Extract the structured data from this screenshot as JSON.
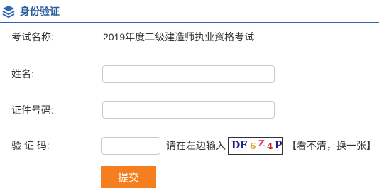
{
  "header": {
    "title": "身份验证",
    "icon": "layers-icon"
  },
  "form": {
    "exam_label": "考试名称:",
    "exam_value": "2019年度二级建造师执业资格考试",
    "name_label": "姓名:",
    "name_value": "",
    "id_label": "证件号码:",
    "id_value": "",
    "captcha_label": "验 证 码:",
    "captcha_value": "",
    "captcha_hint": "请在左边输入",
    "captcha_chars": [
      "D",
      "F",
      "6",
      "Z",
      "4",
      "P"
    ],
    "refresh_label": "【看不清，换一张】",
    "submit_label": "提交"
  },
  "colors": {
    "header_accent": "#2d66b4",
    "submit_bg": "#f57e1f"
  }
}
